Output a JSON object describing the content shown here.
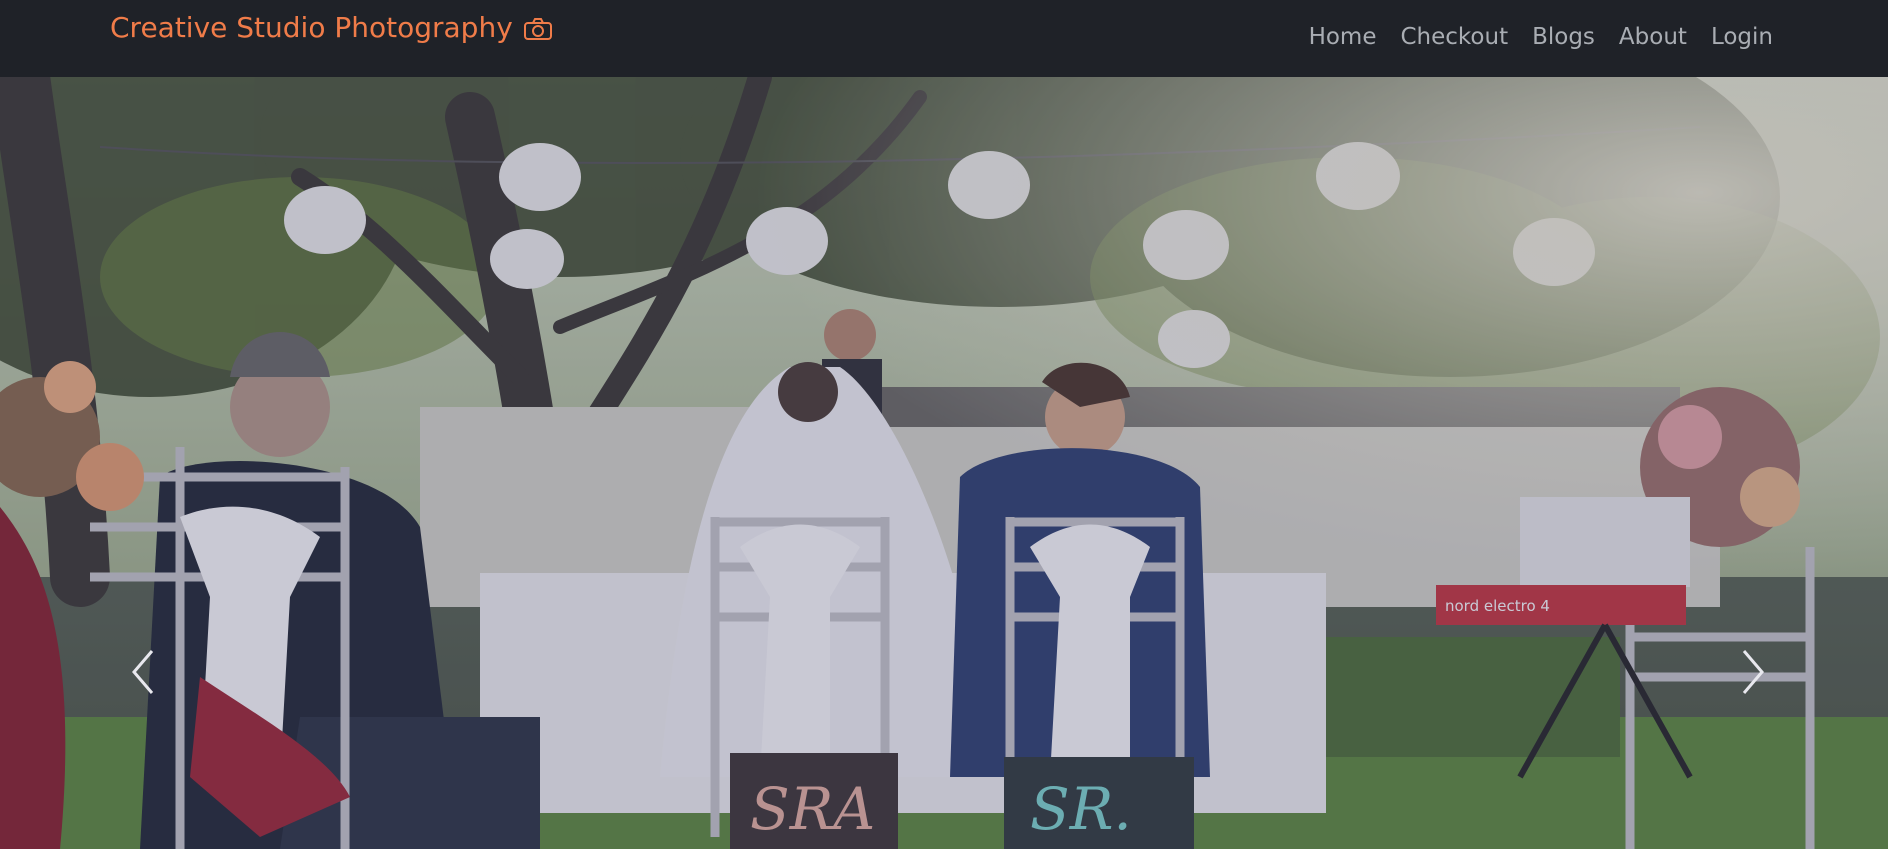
{
  "navbar": {
    "brand": "Creative Studio Photography",
    "brand_icon": "camera-icon",
    "links": [
      "Home",
      "Checkout",
      "Blogs",
      "About",
      "Login"
    ]
  },
  "hero": {
    "signs": [
      "SRA",
      "SR."
    ],
    "keyboard_label": "nord electro 4"
  },
  "colors": {
    "navbar_bg": "#1f2228",
    "brand": "#f07c49",
    "nav_link": "#a9adb3"
  }
}
